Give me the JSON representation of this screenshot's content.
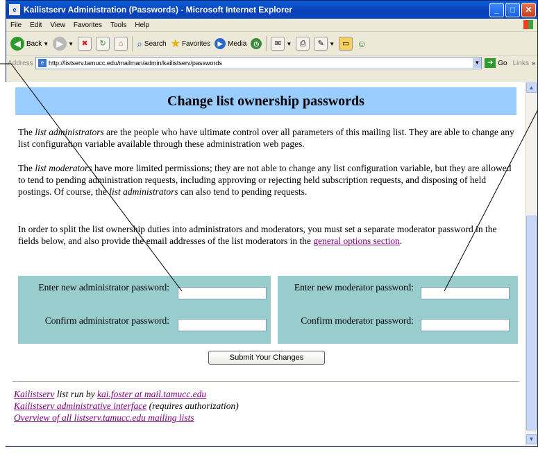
{
  "window": {
    "title": "Kailistserv Administration (Passwords) - Microsoft Internet Explorer",
    "minimize": "_",
    "maximize": "□",
    "close": "✕"
  },
  "menu": [
    "File",
    "Edit",
    "View",
    "Favorites",
    "Tools",
    "Help"
  ],
  "toolbar": {
    "back": "Back",
    "search": "Search",
    "favorites": "Favorites",
    "media": "Media"
  },
  "address": {
    "label": "Address",
    "url": "http://listserv.tamucc.edu/mailman/admin/kailistserv/passwords",
    "go": "Go",
    "links": "Links"
  },
  "page": {
    "heading": "Change list ownership passwords",
    "p1": {
      "t1": "The ",
      "em": "list administrators",
      "t2": " are the people who have ultimate control over all parameters of this mailing list. They are able to change any list configuration variable available through these administration web pages."
    },
    "p2": {
      "t1": "The ",
      "em": "list moderators",
      "t2": " have more limited permissions; they are not able to change any list configuration variable, but they are allowed to tend to pending administration requests, including approving or rejecting held subscription requests, and disposing of held postings. Of course, the ",
      "em2": "list administrators",
      "t3": " can also tend to pending requests."
    },
    "p3": {
      "t1": "In order to split the list ownership duties into administrators and moderators, you must set a separate moderator password in the fields below, and also provide the email addresses of the list moderators in the ",
      "link": "general options section",
      "t2": "."
    },
    "admin_new_label": "Enter new administrator password:",
    "admin_confirm_label": "Confirm administrator password:",
    "mod_new_label": "Enter new moderator password:",
    "mod_confirm_label": "Confirm moderator password:",
    "submit": "Submit Your Changes",
    "footer": {
      "list_name": "Kailistserv",
      "run_by": " list run by ",
      "owner": "kai.foster at mail.tamucc.edu",
      "admin_link": "Kailistserv administrative interface",
      "admin_note": " (requires authorization)",
      "overview": "Overview of all listserv.tamucc.edu mailing lists"
    }
  },
  "colors": {
    "heading_band": "#99ccff",
    "panel": "#99cccc",
    "link": "#800080"
  }
}
